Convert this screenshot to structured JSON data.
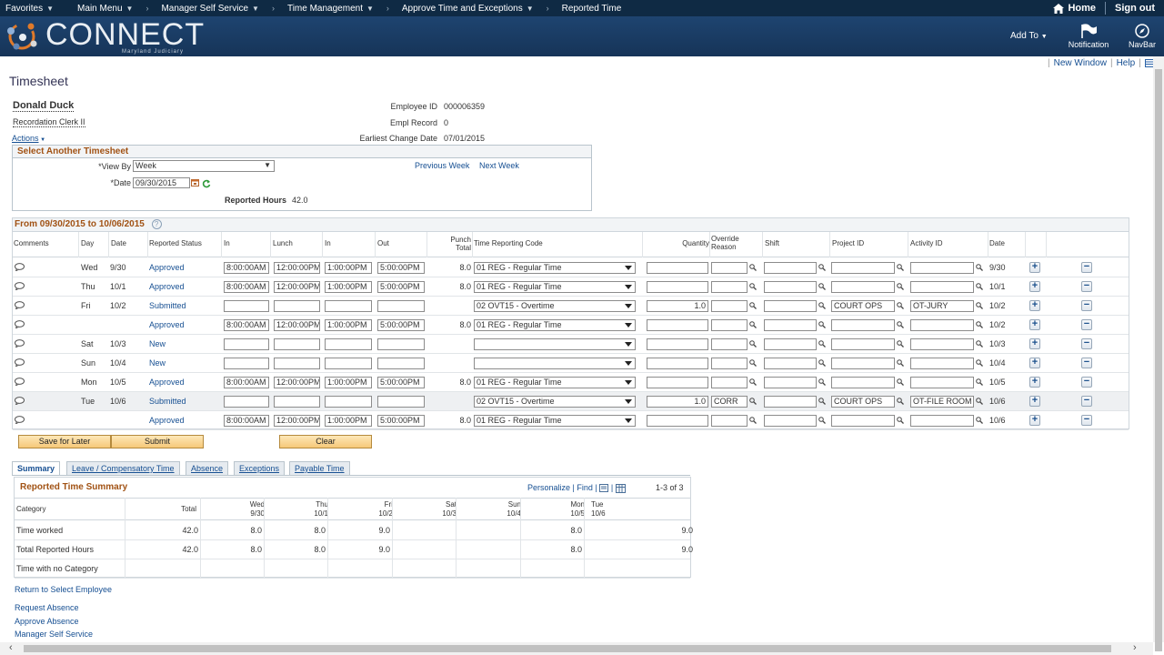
{
  "topnav": {
    "favorites": "Favorites",
    "main_menu": "Main Menu",
    "manager_self_service": "Manager Self Service",
    "time_management": "Time Management",
    "approve_time": "Approve Time and Exceptions",
    "reported_time": "Reported Time",
    "home": "Home",
    "sign_out": "Sign out"
  },
  "banner": {
    "logo_text": "CONNECT",
    "logo_sub": "Maryland Judiciary",
    "add_to": "Add To",
    "notification": "Notification",
    "navbar": "NavBar"
  },
  "toplinks": {
    "new_window": "New Window",
    "help": "Help"
  },
  "page_title": "Timesheet",
  "employee": {
    "name": "Donald Duck",
    "title": "Recordation Clerk II",
    "actions": "Actions",
    "id_label": "Employee ID",
    "id_value": "000006359",
    "rec_label": "Empl Record",
    "rec_value": "0",
    "change_label": "Earliest Change Date",
    "change_value": "07/01/2015"
  },
  "select_box": {
    "title": "Select Another Timesheet",
    "view_by_label": "*View By",
    "view_by_value": "Week",
    "date_label": "*Date",
    "date_value": "09/30/2015",
    "prev_week": "Previous Week",
    "next_week": "Next Week",
    "reported_hours_label": "Reported Hours",
    "reported_hours_value": "42.0"
  },
  "grid": {
    "title": "From 09/30/2015 to 10/06/2015",
    "headers": {
      "comments": "Comments",
      "day": "Day",
      "date": "Date",
      "status": "Reported Status",
      "in1": "In",
      "lunch": "Lunch",
      "in2": "In",
      "out": "Out",
      "punch_total_1": "Punch",
      "punch_total_2": "Total",
      "trc": "Time Reporting Code",
      "quantity": "Quantity",
      "override_1": "Override",
      "override_2": "Reason",
      "shift": "Shift",
      "project": "Project ID",
      "activity": "Activity ID",
      "date2": "Date"
    },
    "rows": [
      {
        "day": "Wed",
        "date": "9/30",
        "status": "Approved",
        "in1": "8:00:00AM",
        "lunch": "12:00:00PM",
        "in2": "1:00:00PM",
        "out": "5:00:00PM",
        "total": "8.0",
        "trc": "01 REG - Regular Time",
        "qty": "",
        "reason": "",
        "project": "",
        "activity": "",
        "date2": "9/30"
      },
      {
        "day": "Thu",
        "date": "10/1",
        "status": "Approved",
        "in1": "8:00:00AM",
        "lunch": "12:00:00PM",
        "in2": "1:00:00PM",
        "out": "5:00:00PM",
        "total": "8.0",
        "trc": "01 REG - Regular Time",
        "qty": "",
        "reason": "",
        "project": "",
        "activity": "",
        "date2": "10/1"
      },
      {
        "day": "Fri",
        "date": "10/2",
        "status": "Submitted",
        "in1": "",
        "lunch": "",
        "in2": "",
        "out": "",
        "total": "",
        "trc": "02 OVT15 - Overtime",
        "qty": "1.0",
        "reason": "",
        "project": "COURT OPS",
        "activity": "OT-JURY",
        "date2": "10/2"
      },
      {
        "day": "",
        "date": "",
        "status": "Approved",
        "in1": "8:00:00AM",
        "lunch": "12:00:00PM",
        "in2": "1:00:00PM",
        "out": "5:00:00PM",
        "total": "8.0",
        "trc": "01 REG - Regular Time",
        "qty": "",
        "reason": "",
        "project": "",
        "activity": "",
        "date2": "10/2"
      },
      {
        "day": "Sat",
        "date": "10/3",
        "status": "New",
        "in1": "",
        "lunch": "",
        "in2": "",
        "out": "",
        "total": "",
        "trc": "",
        "qty": "",
        "reason": "",
        "project": "",
        "activity": "",
        "date2": "10/3"
      },
      {
        "day": "Sun",
        "date": "10/4",
        "status": "New",
        "in1": "",
        "lunch": "",
        "in2": "",
        "out": "",
        "total": "",
        "trc": "",
        "qty": "",
        "reason": "",
        "project": "",
        "activity": "",
        "date2": "10/4"
      },
      {
        "day": "Mon",
        "date": "10/5",
        "status": "Approved",
        "in1": "8:00:00AM",
        "lunch": "12:00:00PM",
        "in2": "1:00:00PM",
        "out": "5:00:00PM",
        "total": "8.0",
        "trc": "01 REG - Regular Time",
        "qty": "",
        "reason": "",
        "project": "",
        "activity": "",
        "date2": "10/5"
      },
      {
        "day": "Tue",
        "date": "10/6",
        "status": "Submitted",
        "in1": "",
        "lunch": "",
        "in2": "",
        "out": "",
        "total": "",
        "trc": "02 OVT15 - Overtime",
        "qty": "1.0",
        "reason": "CORR",
        "project": "COURT OPS",
        "activity": "OT-FILE ROOM",
        "date2": "10/6"
      },
      {
        "day": "",
        "date": "",
        "status": "Approved",
        "in1": "8:00:00AM",
        "lunch": "12:00:00PM",
        "in2": "1:00:00PM",
        "out": "5:00:00PM",
        "total": "8.0",
        "trc": "01 REG - Regular Time",
        "qty": "",
        "reason": "",
        "project": "",
        "activity": "",
        "date2": "10/6"
      }
    ],
    "status_color": "#164f92"
  },
  "buttons": {
    "save_for_later": "Save for Later",
    "submit": "Submit",
    "clear": "Clear"
  },
  "tabs": [
    "Summary",
    "Leave / Compensatory Time",
    "Absence",
    "Exceptions",
    "Payable Time"
  ],
  "summary": {
    "title": "Reported Time Summary",
    "personalize": "Personalize",
    "find": "Find",
    "count": "1-3 of 3",
    "headers": {
      "category": "Category",
      "total": "Total",
      "days": [
        {
          "d": "Wed",
          "dt": "9/30"
        },
        {
          "d": "Thu",
          "dt": "10/1"
        },
        {
          "d": "Fri",
          "dt": "10/2"
        },
        {
          "d": "Sat",
          "dt": "10/3"
        },
        {
          "d": "Sun",
          "dt": "10/4"
        },
        {
          "d": "Mon",
          "dt": "10/5"
        },
        {
          "d": "Tue",
          "dt": "10/6"
        }
      ]
    },
    "rows": [
      {
        "cat": "Time worked",
        "total": "42.0",
        "vals": [
          "8.0",
          "8.0",
          "9.0",
          "",
          "",
          "8.0",
          "9.0"
        ]
      },
      {
        "cat": "Total Reported Hours",
        "total": "42.0",
        "vals": [
          "8.0",
          "8.0",
          "9.0",
          "",
          "",
          "8.0",
          "9.0"
        ]
      },
      {
        "cat": "Time with no Category",
        "total": "",
        "vals": [
          "",
          "",
          "",
          "",
          "",
          "",
          ""
        ]
      }
    ]
  },
  "bottom_links": {
    "return": "Return to Select Employee",
    "request_absence": "Request Absence",
    "approve_absence": "Approve Absence",
    "manager_self_service": "Manager Self Service"
  }
}
